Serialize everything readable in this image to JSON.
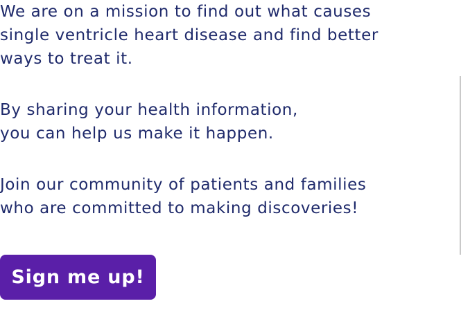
{
  "intro": {
    "lines": [
      "We are on a mission to find out what causes",
      "single ventricle heart disease and find better",
      "ways to treat it."
    ]
  },
  "sharing": {
    "lines": [
      "By sharing your health information,",
      "you can help us make it happen."
    ]
  },
  "community": {
    "lines": [
      "Join our community of patients and families",
      "who are committed to making discoveries!"
    ]
  },
  "cta": {
    "label": "Sign me up!"
  },
  "colors": {
    "text": "#1f2a6b",
    "button_bg": "#5a1fa8",
    "button_text": "#ffffff",
    "divider": "#c9c9c9"
  }
}
